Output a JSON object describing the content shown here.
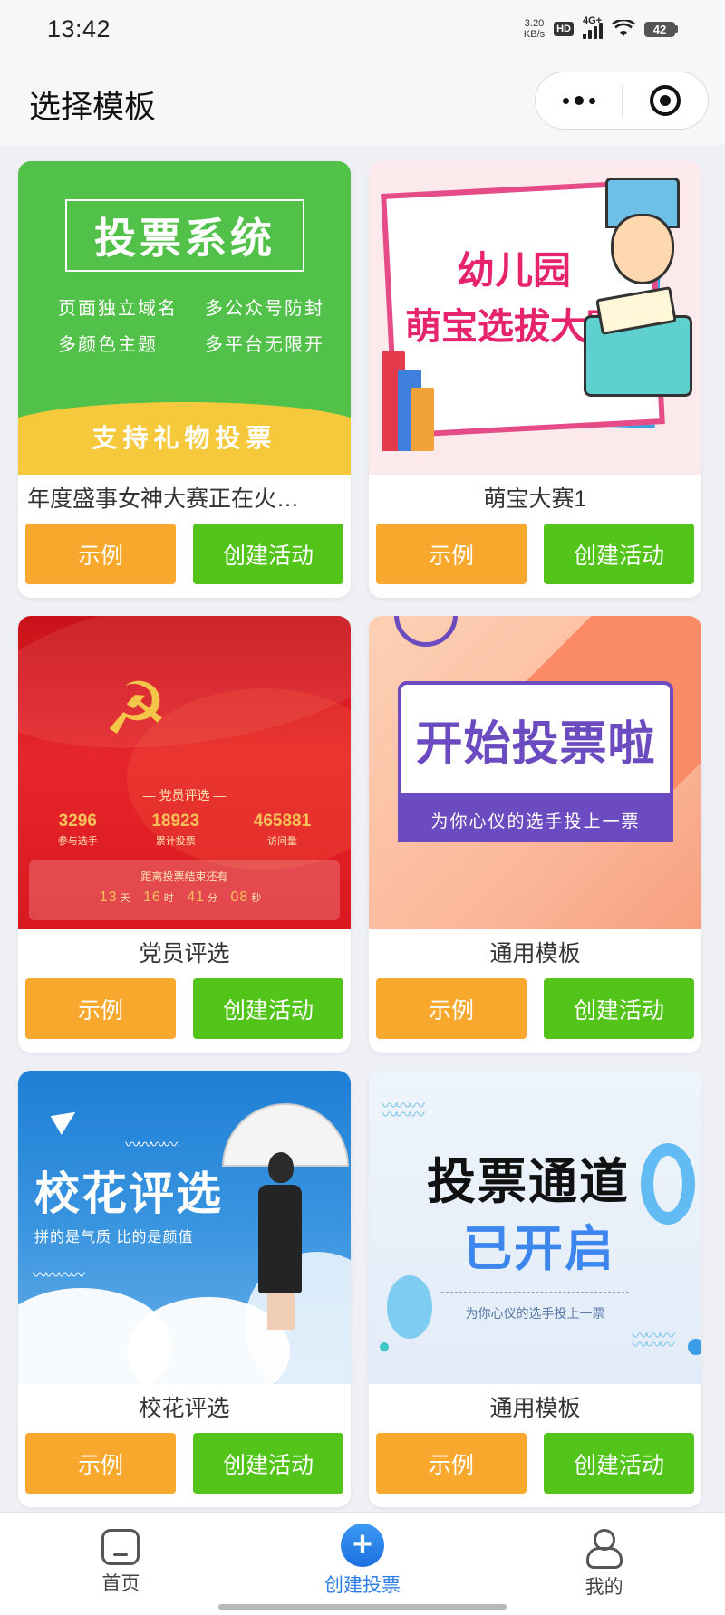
{
  "status_bar": {
    "time": "13:42",
    "net_speed_value": "3.20",
    "net_speed_unit": "KB/s",
    "hd": "HD",
    "network": "4G+",
    "battery": "42"
  },
  "header": {
    "title": "选择模板"
  },
  "buttons": {
    "example": "示例",
    "create": "创建活动"
  },
  "templates": [
    {
      "title": "年度盛事女神大赛正在火…",
      "thumb": {
        "heading": "投票系统",
        "features": [
          "页面独立域名",
          "多公众号防封",
          "多颜色主题",
          "多平台无限开"
        ],
        "banner": "支持礼物投票"
      }
    },
    {
      "title": "萌宝大赛1",
      "thumb": {
        "line1": "幼儿园",
        "line2": "萌宝选拔大赛"
      }
    },
    {
      "title": "党员评选",
      "thumb": {
        "heading": "党员评选",
        "stats": [
          {
            "value": "3296",
            "label": "参与选手"
          },
          {
            "value": "18923",
            "label": "累计投票"
          },
          {
            "value": "465881",
            "label": "访问量"
          }
        ],
        "countdown_title": "距离投票结束还有",
        "countdown": [
          {
            "value": "13",
            "unit": "天"
          },
          {
            "value": "16",
            "unit": "时"
          },
          {
            "value": "41",
            "unit": "分"
          },
          {
            "value": "08",
            "unit": "秒"
          }
        ]
      }
    },
    {
      "title": "通用模板",
      "thumb": {
        "heading": "开始投票啦",
        "strip": "为你心仪的选手投上一票"
      }
    },
    {
      "title": "校花评选",
      "thumb": {
        "heading": "校花评选",
        "sub": "拼的是气质 比的是颜值"
      }
    },
    {
      "title": "通用模板",
      "thumb": {
        "line1": "投票通道",
        "line2": "已开启",
        "sub": "为你心仪的选手投上一票"
      }
    }
  ],
  "tab_bar": {
    "items": [
      {
        "label": "首页",
        "icon": "home-icon"
      },
      {
        "label": "创建投票",
        "icon": "plus-icon",
        "active": true
      },
      {
        "label": "我的",
        "icon": "user-icon"
      }
    ],
    "active_color": "#2f7fe8"
  },
  "colors": {
    "example_button": "#f8a82c",
    "create_button": "#52c41a"
  }
}
